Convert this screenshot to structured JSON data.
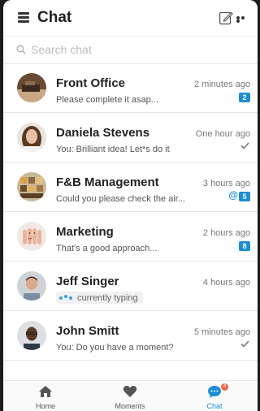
{
  "header": {
    "title": "Chat",
    "compose_icon": "compose-icon",
    "more_icon": "more-icon"
  },
  "search": {
    "placeholder": "Search chat"
  },
  "colors": {
    "accent": "#1b8fd6",
    "notification": "#f0694b"
  },
  "chats": [
    {
      "name": "Front Office",
      "preview": "Please complete it asap...",
      "time": "2 minutes ago",
      "badge": "2"
    },
    {
      "name": "Daniela Stevens",
      "preview": "You: Brilliant idea! Let*s do it",
      "time": "One hour ago",
      "status": "read"
    },
    {
      "name": "F&B Management",
      "preview": "Could you please check the air...",
      "time": "3 hours ago",
      "mention": "@",
      "badge": "5"
    },
    {
      "name": "Marketing",
      "preview": "That's a good approach...",
      "time": "2 hours ago",
      "badge": "8"
    },
    {
      "name": "Jeff Singer",
      "typing": "currently typing",
      "time": "4 hours ago"
    },
    {
      "name": "John Smitt",
      "preview": "You: Do you have a moment?",
      "time": "5 minutes ago",
      "status": "read"
    }
  ],
  "nav": [
    {
      "label": "Home",
      "icon": "home-icon"
    },
    {
      "label": "Moments",
      "icon": "heart-icon"
    },
    {
      "label": "Chat",
      "icon": "chat-icon",
      "active": true,
      "notification": "4"
    }
  ]
}
